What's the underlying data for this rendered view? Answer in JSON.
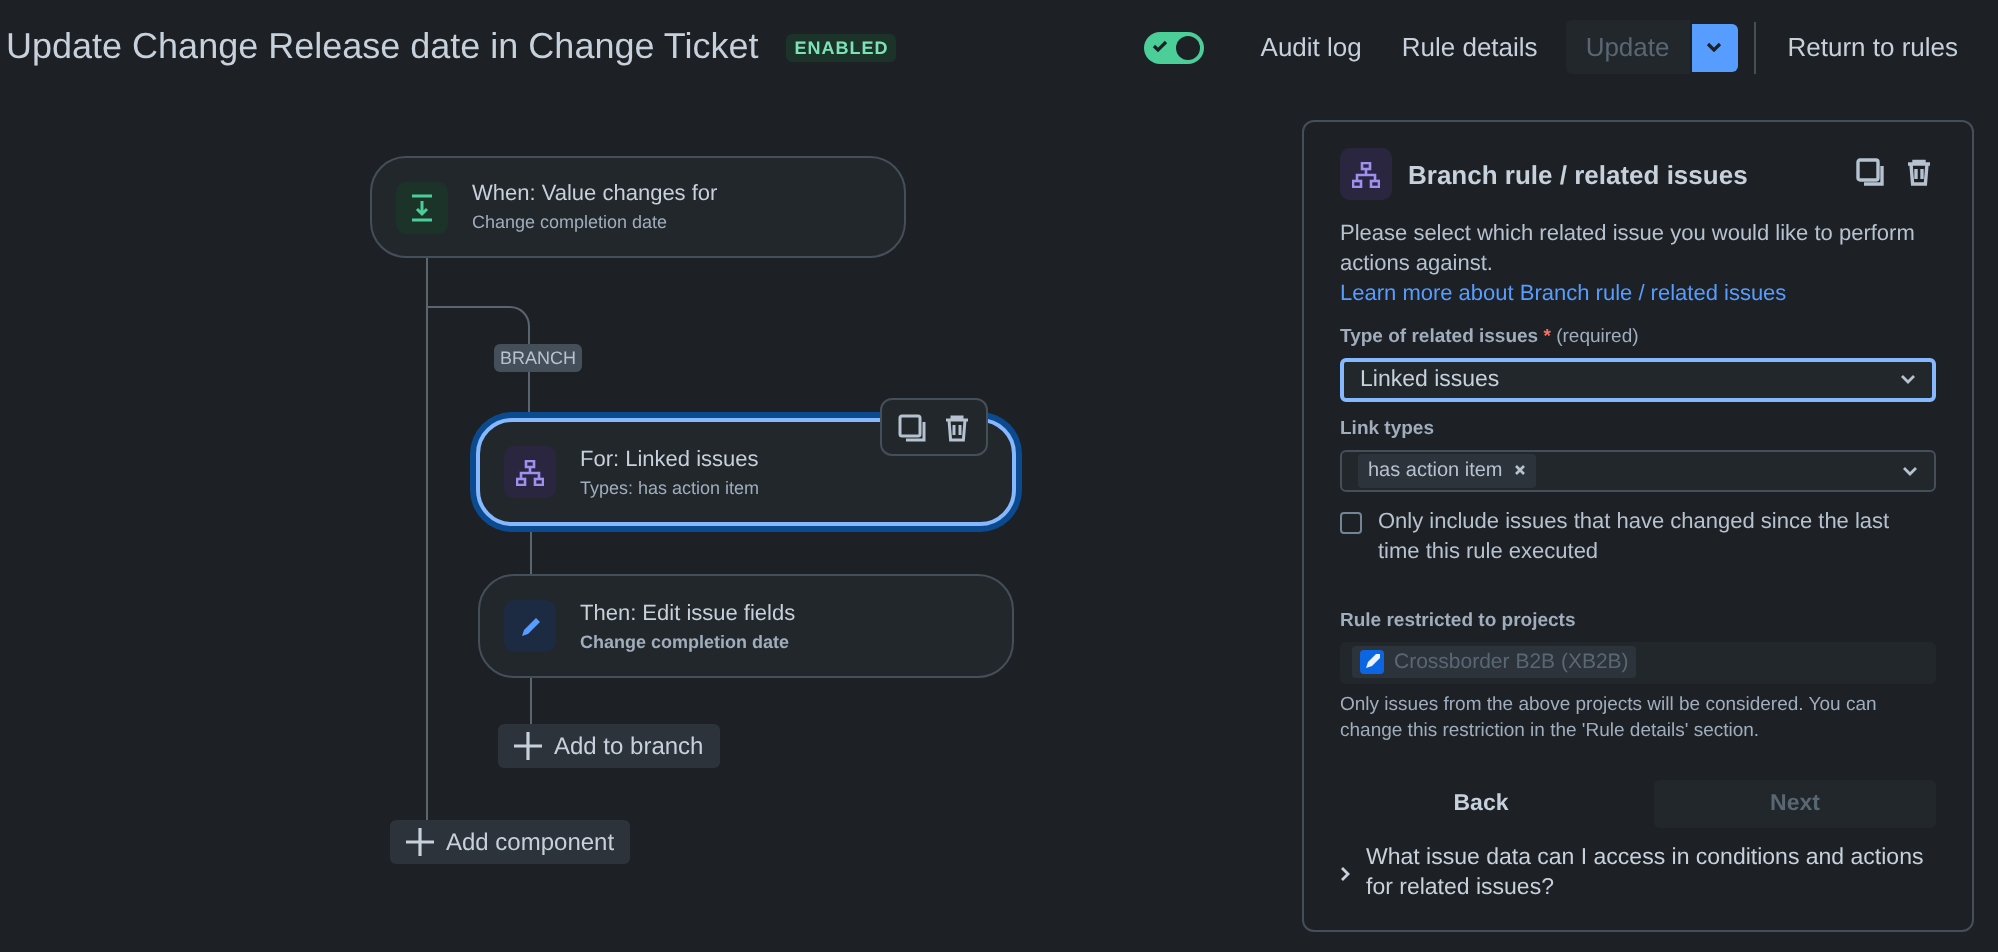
{
  "header": {
    "title": "Update Change Release date in Change Ticket",
    "status_badge": "ENABLED",
    "toggle": {
      "on": true
    },
    "links": [
      "Audit log",
      "Rule details"
    ],
    "update_button": {
      "label": "Update",
      "disabled": true
    },
    "return_link": "Return to rules"
  },
  "canvas": {
    "trigger": {
      "kind": "trigger",
      "title": "When: Value changes for",
      "subtitle": "Change completion date"
    },
    "branch_label": "BRANCH",
    "branch_nodes": [
      {
        "kind": "branch",
        "title": "For: Linked issues",
        "subtitle": "Types: has action item",
        "selected": true
      },
      {
        "kind": "action",
        "title": "Then: Edit issue fields",
        "subtitle": "Change completion date",
        "selected": false
      }
    ],
    "add_to_branch": "Add to branch",
    "add_component": "Add component"
  },
  "panel": {
    "title": "Branch rule / related issues",
    "description": "Please select which related issue you would like to perform actions against.",
    "learn_more_link": "Learn more about Branch rule / related issues",
    "type_field": {
      "label": "Type of related issues",
      "required_mark": "*",
      "required_note": "(required)",
      "value": "Linked issues",
      "focused": true
    },
    "link_types_field": {
      "label": "Link types",
      "tags": [
        "has action item"
      ]
    },
    "changed_only_checkbox": {
      "label": "Only include issues that have changed since the last time this rule executed",
      "checked": false
    },
    "projects_field": {
      "label": "Rule restricted to projects",
      "projects": [
        "Crossborder B2B (XB2B)"
      ],
      "disabled": true
    },
    "help_text": "Only issues from the above projects will be considered. You can change this restriction in the 'Rule details' section.",
    "back_button": {
      "label": "Back",
      "disabled": false
    },
    "next_button": {
      "label": "Next",
      "disabled": true
    },
    "faq": {
      "label": "What issue data can I access in conditions and actions for related issues?",
      "expanded": false
    }
  }
}
